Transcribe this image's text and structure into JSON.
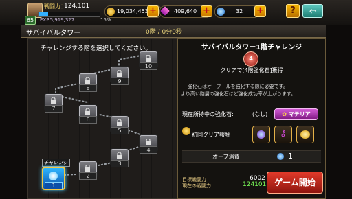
{
  "player": {
    "level": "65",
    "battle_power_label": "戦闘力：",
    "battle_power": "124,101",
    "exp_label": "EXP.5,919,327",
    "exp_percent": "15%"
  },
  "currency": {
    "gold": "19,034,453",
    "gems": "409,640",
    "orbs": "32"
  },
  "header": {
    "title": "サバイバルタワー",
    "progress": "0階 / 0分0秒"
  },
  "left": {
    "prompt": "チャレンジする階を選択してください。",
    "challenge_tag": "チャレンジ",
    "floors": [
      "1",
      "2",
      "3",
      "4",
      "5",
      "6",
      "7",
      "8",
      "9",
      "10"
    ]
  },
  "right": {
    "title": "サバイバルタワー1階チャレンジ",
    "reward_line": "クリアで[4階強化石]獲得",
    "desc_line1": "強化石はオーブールを強化する際に必要です。",
    "desc_line2": "より高い階層の強化石ほど強化成功率が上がります。",
    "stone_label": "現在所持中の強化石:",
    "stone_value": "(なし)",
    "materia_button": "マテリア",
    "first_clear_label": "初回クリア報酬",
    "orb_cost_label": "オーブ消費",
    "orb_cost_value": "1",
    "target_label": "目標戦闘力",
    "target_value": "6002",
    "current_label": "現在の戦闘力",
    "current_value": "124101",
    "start_button": "ゲーム開始"
  },
  "icons": [
    "help-icon",
    "back-arrow-icon",
    "gold-coin-icon",
    "gem-icon",
    "orb-icon",
    "lock-icon"
  ],
  "colors": {
    "accent_red": "#d32f2f",
    "gold": "#f4b400",
    "green_value": "#7cff5a",
    "back_button": "#2fa39a"
  }
}
